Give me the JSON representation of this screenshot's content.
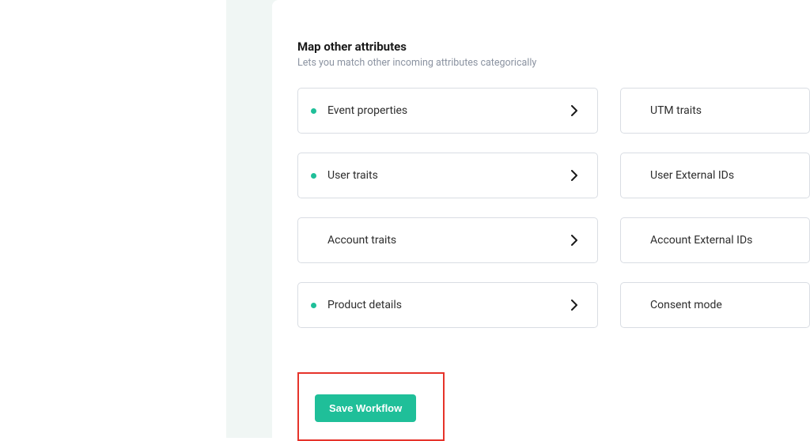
{
  "section": {
    "title": "Map other attributes",
    "subtitle": "Lets you match other incoming attributes categorically"
  },
  "left_items": [
    {
      "label": "Event properties",
      "active": true
    },
    {
      "label": "User traits",
      "active": true
    },
    {
      "label": "Account traits",
      "active": false
    },
    {
      "label": "Product details",
      "active": true
    }
  ],
  "right_items": [
    {
      "label": "UTM traits"
    },
    {
      "label": "User External IDs"
    },
    {
      "label": "Account External IDs"
    },
    {
      "label": "Consent mode"
    }
  ],
  "actions": {
    "save": "Save Workflow"
  },
  "colors": {
    "accent": "#1fbf99",
    "highlight_border": "#e6332a"
  }
}
